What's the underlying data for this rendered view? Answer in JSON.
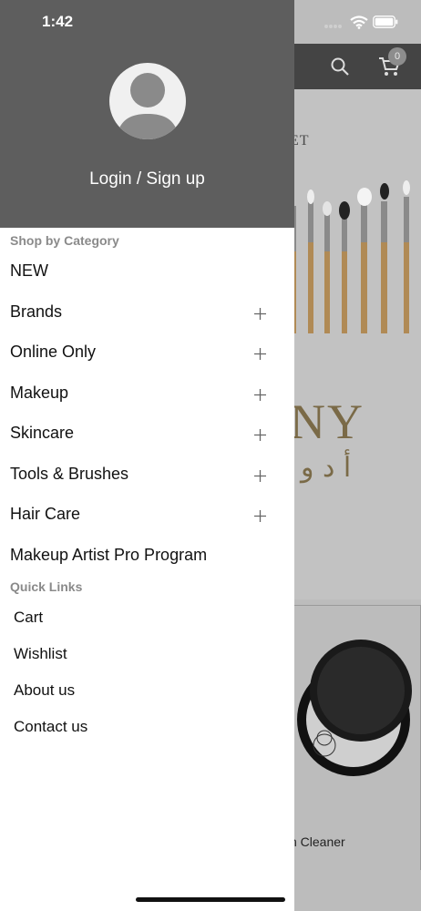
{
  "status_bar": {
    "time": "1:42"
  },
  "background": {
    "cart_count": "0",
    "banner_text": "ET",
    "brand_text": "NY",
    "brand_arabic": "أ د و",
    "product_name": "h Cleaner",
    "header_color": "#444444"
  },
  "drawer": {
    "login_label": "Login / Sign up",
    "shop_by_category_label": "Shop by Category",
    "categories": [
      {
        "label": "NEW",
        "expandable": false
      },
      {
        "label": "Brands",
        "expandable": true
      },
      {
        "label": "Online Only",
        "expandable": true
      },
      {
        "label": "Makeup",
        "expandable": true
      },
      {
        "label": "Skincare",
        "expandable": true
      },
      {
        "label": "Tools & Brushes",
        "expandable": true
      },
      {
        "label": "Hair Care",
        "expandable": true
      },
      {
        "label": "Makeup Artist Pro Program",
        "expandable": false
      }
    ],
    "quick_links_label": "Quick Links",
    "quick_links": [
      {
        "label": "Cart"
      },
      {
        "label": "Wishlist"
      },
      {
        "label": "About us"
      },
      {
        "label": "Contact us"
      }
    ],
    "header_color": "#5e5e5e",
    "icons": {
      "avatar": "user-avatar-icon",
      "expand": "plus-icon"
    }
  }
}
